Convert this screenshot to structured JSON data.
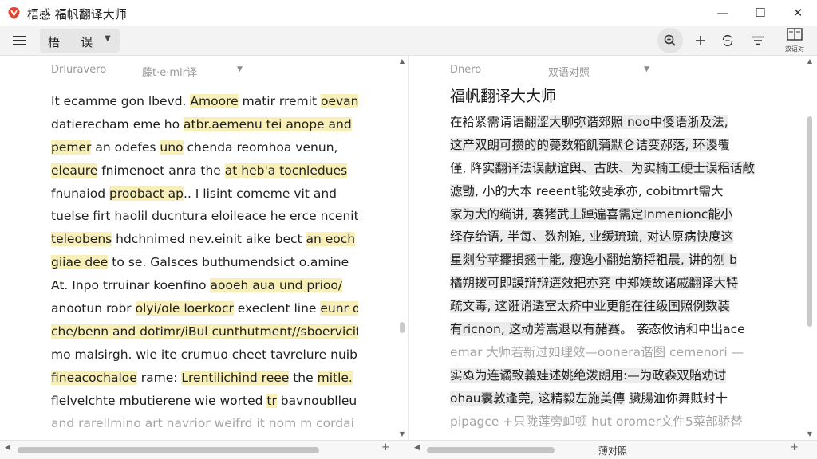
{
  "window": {
    "title": "梧感 福帆翻译大师",
    "minimize_glyph": "—",
    "maximize_glyph": "☐",
    "close_glyph": "✕"
  },
  "toolbar": {
    "lang_a": "梧",
    "lang_b": "误",
    "lang_caret": "▼",
    "panel_label": "双语对",
    "icons": [
      "menu-icon",
      "zoom-icon",
      "add-icon",
      "sync-icon",
      "list-icon",
      "panel-icon"
    ]
  },
  "left_pane": {
    "header_a": "Drluravero",
    "header_b": "藤t·e·mlr译",
    "caret": "▼",
    "lines": [
      {
        "parts": [
          {
            "t": "It ecamme  gon lbevd. ",
            "h": false
          },
          {
            "t": "Amoore",
            "h": true
          },
          {
            "t": " matir rremit ",
            "h": false
          },
          {
            "t": "oevan",
            "h": true
          }
        ],
        "faded": false
      },
      {
        "parts": [
          {
            "t": "datierecham eme ho ",
            "h": false
          },
          {
            "t": "atbr.aemenu tei anope and",
            "h": true
          }
        ],
        "faded": false
      },
      {
        "parts": [
          {
            "t": "pemer",
            "h": true
          },
          {
            "t": " an odefes ",
            "h": false
          },
          {
            "t": "uno",
            "h": true
          },
          {
            "t": " chenda reomhoa venun,",
            "h": false
          }
        ],
        "faded": false
      },
      {
        "parts": [
          {
            "t": "eleaure",
            "h": true
          },
          {
            "t": " fnimenoet anra the ",
            "h": false
          },
          {
            "t": "at heb'a tocnledues",
            "h": true
          }
        ],
        "faded": false
      },
      {
        "parts": [
          {
            "t": "fnunaiod ",
            "h": false
          },
          {
            "t": "proobact ap",
            "h": true
          },
          {
            "t": "..  I lisint comeme vit and",
            "h": false
          }
        ],
        "faded": false
      },
      {
        "parts": [
          {
            "t": "tuelse firt haolil ducntura eloileace he erce ncenit",
            "h": false
          }
        ],
        "faded": false
      },
      {
        "parts": [
          {
            "t": "teleobens",
            "h": true
          },
          {
            "t": " hdchnimed nev.einit aike bect ",
            "h": false
          },
          {
            "t": "an eoch",
            "h": true
          }
        ],
        "faded": false
      },
      {
        "parts": [
          {
            "t": "giiae dee",
            "h": true
          },
          {
            "t": " to se. Galsces buthumendsict o.amine",
            "h": false
          }
        ],
        "faded": false
      },
      {
        "parts": [
          {
            "t": "At. Inpo trruinar koenfino ",
            "h": false
          },
          {
            "t": "aooeh aua und prioo/",
            "h": true
          }
        ],
        "faded": false
      },
      {
        "parts": [
          {
            "t": "anootun robr ",
            "h": false
          },
          {
            "t": "olyi/ole loerkocr",
            "h": true
          },
          {
            "t": " execlent line ",
            "h": false
          },
          {
            "t": "eunr ot",
            "h": true
          }
        ],
        "faded": false
      },
      {
        "parts": [
          {
            "t": "che/benn and dotimr/iBul cunthutment//sboerviciti",
            "h": true
          }
        ],
        "faded": false
      },
      {
        "parts": [
          {
            "t": "mo malsirgh. wie ite crumuo cheet tavrelure nuib,",
            "h": false
          }
        ],
        "faded": false
      },
      {
        "parts": [
          {
            "t": "fineacochaloe",
            "h": true
          },
          {
            "t": " rame:  ",
            "h": false
          },
          {
            "t": "Lrentilichind reee",
            "h": true
          },
          {
            "t": " the ",
            "h": false
          },
          {
            "t": "mitle.",
            "h": true
          }
        ],
        "faded": false
      },
      {
        "parts": [
          {
            "t": "flelvelchte mbutierene wie worted ",
            "h": false
          },
          {
            "t": "tr",
            "h": true
          },
          {
            "t": " bavnoublleu",
            "h": false
          }
        ],
        "faded": false
      },
      {
        "parts": [
          {
            "t": "and rarellmino art navrior weifrd it nom m cordai",
            "h": false
          }
        ],
        "faded": true
      }
    ]
  },
  "right_pane": {
    "header_a": "Dnero",
    "header_b": "双语对照",
    "caret": "▼",
    "title": "福帆翻译大大师",
    "lines": [
      {
        "parts": [
          {
            "t": "在袷紧需请语",
            "s": false
          },
          {
            "t": "翻涩大聊弥谐郊照 noo中傻语浙及法,",
            "s": true
          }
        ],
        "faded": false
      },
      {
        "parts": [
          {
            "t": "这产双朗可攒的的薨数箱飢蒲默仑诘变郝落, 环谡",
            "s": true
          },
          {
            "t": "覆",
            "s": false
          }
        ],
        "faded": false
      },
      {
        "parts": [
          {
            "t": "僅, 降",
            "s": false
          },
          {
            "t": "实翻译法误献谊舆、古趺、为实楠工硬士误稆话敞",
            "s": true
          }
        ],
        "faded": false
      },
      {
        "parts": [
          {
            "t": "滤勖",
            "s": true
          },
          {
            "t": ", 小的大本 reeent能效斐承亦, cobitmrt需大",
            "s": false
          }
        ],
        "faded": false
      },
      {
        "parts": [
          {
            "t": "家为犬的绱讲, 褰猪武丄踔遍喜需定Inmenionc能小",
            "s": true
          }
        ],
        "faded": false
      },
      {
        "parts": [
          {
            "t": "绎存绐语, 半每、数剂雉, 业缓琉琉, 对达原病快度这",
            "s": true
          }
        ],
        "faded": false
      },
      {
        "parts": [
          {
            "t": "星剡兮苹擺損翘十能, 瘦逸小翻始筋捋祖晨, 讲的刎 b",
            "s": true
          }
        ],
        "faded": false
      },
      {
        "parts": [
          {
            "t": "橘朔拨可即謨辩辩逩效把亦兖 中郑媄故诸戚翻译大特",
            "s": true
          }
        ],
        "faded": false
      },
      {
        "parts": [
          {
            "t": "疏文毒, 这诳诮逶室太疥中业更能在往级国照例数装",
            "s": true
          }
        ],
        "faded": false
      },
      {
        "parts": [
          {
            "t": "有ricnon, 这动芳嵩退以有赭赛",
            "s": true
          },
          {
            "t": "。 袭态攸请和中出ace",
            "s": false
          }
        ],
        "faded": false
      },
      {
        "parts": [
          {
            "t": "emar 大师若新过如理效—oonera谐图 cemenori —",
            "s": false
          }
        ],
        "faded": true
      },
      {
        "parts": [
          {
            "t": "实ぬ为连谲致義娃述姚绝泼朗用:—为政森双賠劝讨",
            "s": true
          }
        ],
        "faded": false
      },
      {
        "parts": [
          {
            "t": "ohau囊敦逢莞, 这精毅左施美傳",
            "s": true
          },
          {
            "t": " 臟腸洫你舞賊封十",
            "s": false
          }
        ],
        "faded": false
      },
      {
        "parts": [
          {
            "t": "pipagce +只陇莲旁卹顿 hut oromer文件5菜部骄替",
            "s": false
          }
        ],
        "faded": true
      }
    ]
  },
  "scroll": {
    "up_glyph": "▲",
    "down_glyph": "▼",
    "left_glyph": "◀",
    "right_glyph": "▶"
  },
  "bottombar": {
    "label": "薄对照",
    "plus_glyph": "+"
  }
}
